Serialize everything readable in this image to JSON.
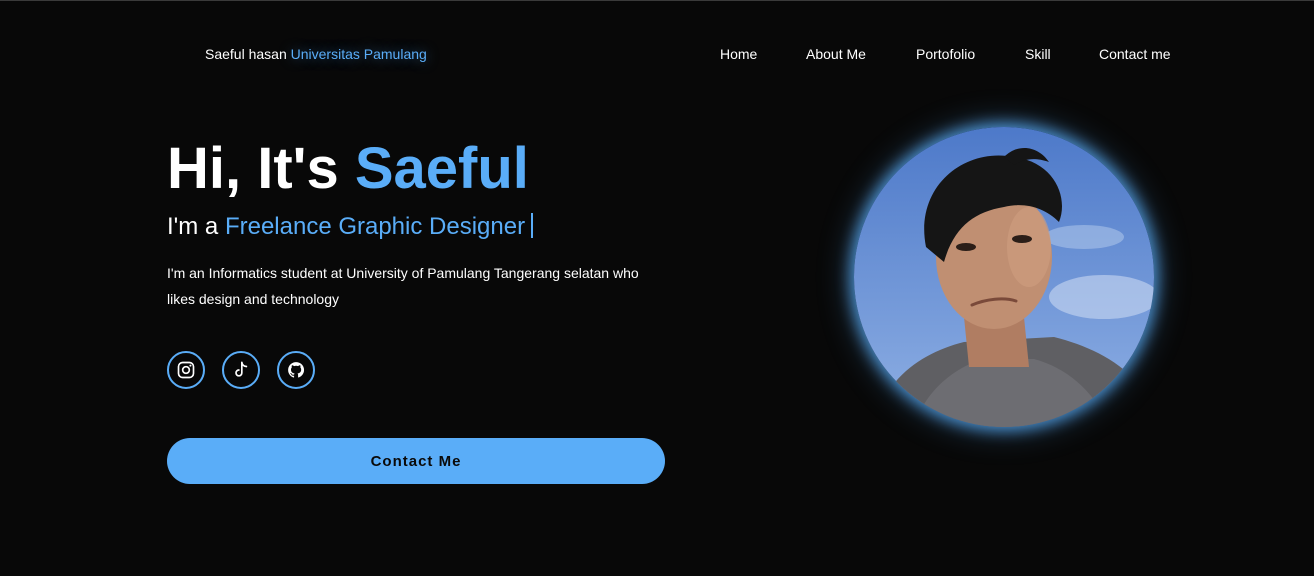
{
  "header": {
    "brand_name": "Saeful hasan",
    "brand_accent": "Universitas Pamulang"
  },
  "nav": {
    "items": [
      "Home",
      "About Me",
      "Portofolio",
      "Skill",
      "Contact me"
    ]
  },
  "hero": {
    "greeting": "Hi, It's",
    "name": "Saeful",
    "role_prefix": "I'm a",
    "role": "Freelance Graphic Designer",
    "description": "I'm an Informatics student at University of Pamulang Tangerang selatan who likes design and technology",
    "cta_label": "Contact Me"
  },
  "socials": [
    {
      "icon": "instagram-icon"
    },
    {
      "icon": "tiktok-icon"
    },
    {
      "icon": "github-icon"
    }
  ],
  "colors": {
    "background": "#080808",
    "accent": "#5aadf8",
    "text": "#ffffff"
  }
}
